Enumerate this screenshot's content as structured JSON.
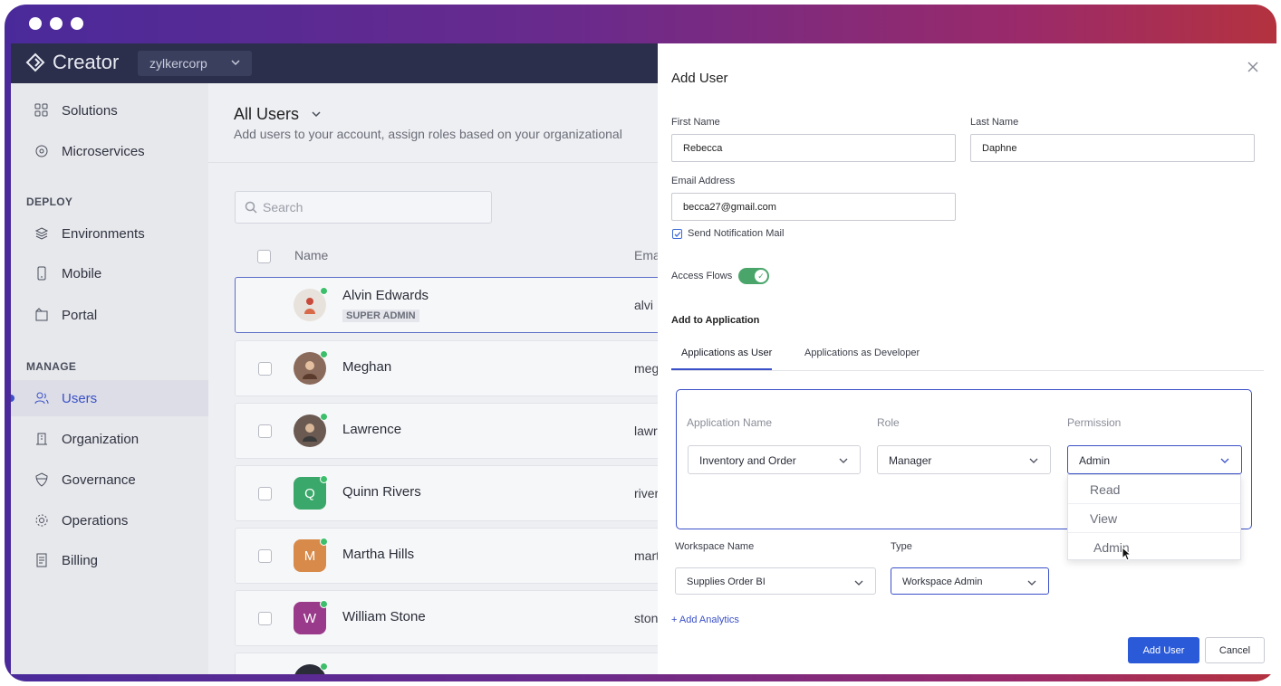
{
  "app": {
    "name": "Creator",
    "org": "zylkercorp"
  },
  "sidebar": {
    "items_top": [
      {
        "label": "Solutions",
        "icon": "grid-icon"
      },
      {
        "label": "Microservices",
        "icon": "microservice-icon"
      }
    ],
    "deploy_heading": "DEPLOY",
    "deploy_items": [
      {
        "label": "Environments",
        "icon": "layers-icon"
      },
      {
        "label": "Mobile",
        "icon": "mobile-icon"
      },
      {
        "label": "Portal",
        "icon": "portal-icon"
      }
    ],
    "manage_heading": "MANAGE",
    "manage_items": [
      {
        "label": "Users",
        "icon": "users-icon",
        "active": true
      },
      {
        "label": "Organization",
        "icon": "building-icon"
      },
      {
        "label": "Governance",
        "icon": "shield-icon"
      },
      {
        "label": "Operations",
        "icon": "gear-icon"
      },
      {
        "label": "Billing",
        "icon": "billing-icon"
      }
    ]
  },
  "main": {
    "title": "All Users",
    "subtitle": "Add users to your account, assign roles based on your organizational",
    "search_placeholder": "Search",
    "columns": {
      "name": "Name",
      "email": "Ema"
    },
    "users": [
      {
        "name": "Alvin Edwards",
        "badge": "SUPER ADMIN",
        "email_peek": "alvi",
        "avatar_color": "#e8e2dc",
        "initial": ""
      },
      {
        "name": "Meghan",
        "email_peek": "meg",
        "avatar_color": "#8a6a5a",
        "initial": ""
      },
      {
        "name": "Lawrence",
        "email_peek": "lawr",
        "avatar_color": "#6a5a52",
        "initial": ""
      },
      {
        "name": "Quinn Rivers",
        "email_peek": "river",
        "avatar_color": "#3aa86a",
        "initial": "Q"
      },
      {
        "name": "Martha Hills",
        "email_peek": "mart",
        "avatar_color": "#d88a4a",
        "initial": "M"
      },
      {
        "name": "William Stone",
        "email_peek": "ston",
        "avatar_color": "#9a3a8a",
        "initial": "W"
      }
    ]
  },
  "panel": {
    "title": "Add User",
    "first_name_label": "First Name",
    "first_name": "Rebecca",
    "last_name_label": "Last Name",
    "last_name": "Daphne",
    "email_label": "Email Address",
    "email": "becca27@gmail.com",
    "send_notification": "Send Notification Mail",
    "access_flows": "Access Flows",
    "add_to_application": "Add to Application",
    "tabs": [
      "Applications as User",
      "Applications as Developer"
    ],
    "app_name_label": "Application Name",
    "role_label": "Role",
    "permission_label": "Permission",
    "app_name": "Inventory and Order",
    "role": "Manager",
    "permission": "Admin",
    "permission_options": [
      "Read",
      "View",
      "Admin"
    ],
    "workspace_name_label": "Workspace Name",
    "type_label": "Type",
    "workspace_name": "Supplies Order BI",
    "type": "Workspace Admin",
    "add_analytics": "+ Add Analytics",
    "add_user_button": "Add User",
    "cancel_button": "Cancel"
  },
  "colors": {
    "accent": "#3a50c8",
    "topbar": "#2b2f4c",
    "online": "#3cbf6a",
    "toggle_on": "#4aa56a"
  }
}
